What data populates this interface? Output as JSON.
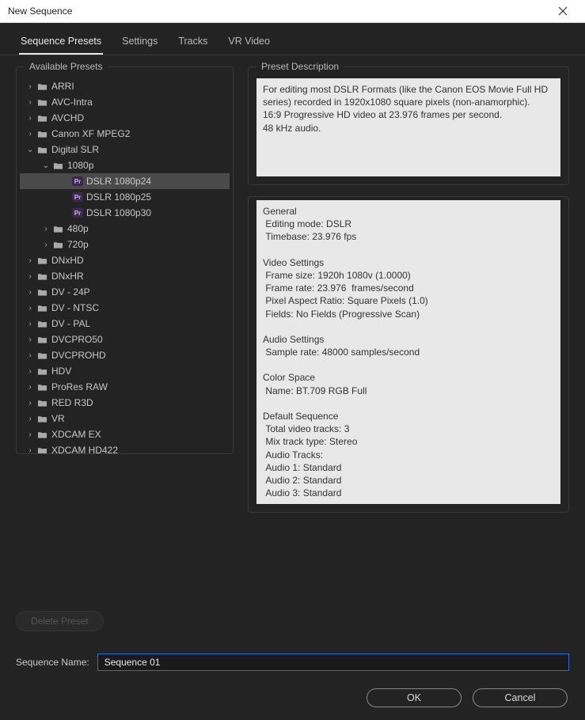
{
  "window": {
    "title": "New Sequence"
  },
  "tabs": {
    "items": [
      {
        "label": "Sequence Presets",
        "active": true
      },
      {
        "label": "Settings",
        "active": false
      },
      {
        "label": "Tracks",
        "active": false
      },
      {
        "label": "VR Video",
        "active": false
      }
    ]
  },
  "left": {
    "title": "Available Presets",
    "tree": [
      {
        "type": "folder",
        "label": "ARRI",
        "depth": 1,
        "expanded": false
      },
      {
        "type": "folder",
        "label": "AVC-Intra",
        "depth": 1,
        "expanded": false
      },
      {
        "type": "folder",
        "label": "AVCHD",
        "depth": 1,
        "expanded": false
      },
      {
        "type": "folder",
        "label": "Canon XF MPEG2",
        "depth": 1,
        "expanded": false
      },
      {
        "type": "folder",
        "label": "Digital SLR",
        "depth": 1,
        "expanded": true
      },
      {
        "type": "folder",
        "label": "1080p",
        "depth": 2,
        "expanded": true
      },
      {
        "type": "preset",
        "label": "DSLR 1080p24",
        "depth": 3,
        "selected": true
      },
      {
        "type": "preset",
        "label": "DSLR 1080p25",
        "depth": 3
      },
      {
        "type": "preset",
        "label": "DSLR 1080p30",
        "depth": 3
      },
      {
        "type": "folder",
        "label": "480p",
        "depth": 2,
        "expanded": false
      },
      {
        "type": "folder",
        "label": "720p",
        "depth": 2,
        "expanded": false
      },
      {
        "type": "folder",
        "label": "DNxHD",
        "depth": 1,
        "expanded": false
      },
      {
        "type": "folder",
        "label": "DNxHR",
        "depth": 1,
        "expanded": false
      },
      {
        "type": "folder",
        "label": "DV - 24P",
        "depth": 1,
        "expanded": false
      },
      {
        "type": "folder",
        "label": "DV - NTSC",
        "depth": 1,
        "expanded": false
      },
      {
        "type": "folder",
        "label": "DV - PAL",
        "depth": 1,
        "expanded": false
      },
      {
        "type": "folder",
        "label": "DVCPRO50",
        "depth": 1,
        "expanded": false
      },
      {
        "type": "folder",
        "label": "DVCPROHD",
        "depth": 1,
        "expanded": false
      },
      {
        "type": "folder",
        "label": "HDV",
        "depth": 1,
        "expanded": false
      },
      {
        "type": "folder",
        "label": "ProRes RAW",
        "depth": 1,
        "expanded": false
      },
      {
        "type": "folder",
        "label": "RED R3D",
        "depth": 1,
        "expanded": false
      },
      {
        "type": "folder",
        "label": "VR",
        "depth": 1,
        "expanded": false
      },
      {
        "type": "folder",
        "label": "XDCAM EX",
        "depth": 1,
        "expanded": false
      },
      {
        "type": "folder",
        "label": "XDCAM HD422",
        "depth": 1,
        "expanded": false
      }
    ]
  },
  "right": {
    "title": "Preset Description",
    "description": "For editing most DSLR Formats (like the Canon EOS Movie Full HD series) recorded in 1920x1080 square pixels (non-anamorphic).\n16:9 Progressive HD video at 23.976 frames per second.\n48 kHz audio.",
    "details": "General\n Editing mode: DSLR\n Timebase: 23.976 fps\n\nVideo Settings\n Frame size: 1920h 1080v (1.0000)\n Frame rate: 23.976  frames/second\n Pixel Aspect Ratio: Square Pixels (1.0)\n Fields: No Fields (Progressive Scan)\n\nAudio Settings\n Sample rate: 48000 samples/second\n\nColor Space\n Name: BT.709 RGB Full\n\nDefault Sequence\n Total video tracks: 3\n Mix track type: Stereo\n Audio Tracks:\n Audio 1: Standard\n Audio 2: Standard\n Audio 3: Standard"
  },
  "delete_label": "Delete Preset",
  "sequence_name": {
    "label": "Sequence Name:",
    "value": "Sequence 01"
  },
  "buttons": {
    "ok": "OK",
    "cancel": "Cancel"
  }
}
